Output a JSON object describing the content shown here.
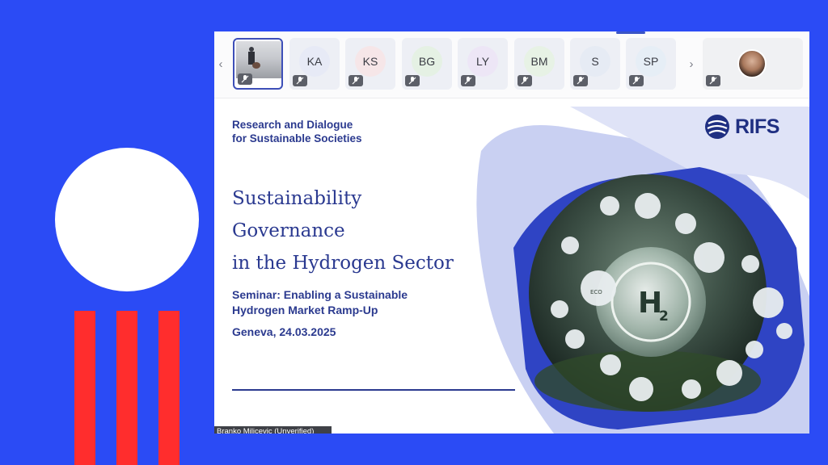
{
  "participants": [
    {
      "initials": "",
      "kind": "video"
    },
    {
      "initials": "KA",
      "color": "#e7eaf6"
    },
    {
      "initials": "KS",
      "color": "#f6e6e8"
    },
    {
      "initials": "BG",
      "color": "#e5f1e4"
    },
    {
      "initials": "LY",
      "color": "#ede6f6"
    },
    {
      "initials": "BM",
      "color": "#e7f2e5"
    },
    {
      "initials": "S",
      "color": "#e6ebf4"
    },
    {
      "initials": "SP",
      "color": "#e6eef6"
    }
  ],
  "nav": {
    "prev_icon": "chevron-left-icon",
    "next_icon": "chevron-right-icon"
  },
  "slide": {
    "org_line1": "Research and Dialogue",
    "org_line2": "for Sustainable Societies",
    "title_line1": "Sustainability",
    "title_line2": "Governance",
    "title_line3": "in the Hydrogen Sector",
    "seminar_line1": "Seminar: Enabling a Sustainable",
    "seminar_line2": "Hydrogen Market Ramp-Up",
    "date": "Geneva, 24.03.2025",
    "logo_text": "RIFS",
    "center_label_h": "H",
    "center_label_sub": "2",
    "eco_label": "ECO"
  },
  "speaker_name": "Branko Milicevic (Unverified)",
  "colors": {
    "background": "#2b4bf5",
    "accent_red": "#ff2d2d",
    "slide_text": "#2b3a8f",
    "shape_blue": "#2f44c4",
    "shape_light": "#a8b3ea"
  }
}
